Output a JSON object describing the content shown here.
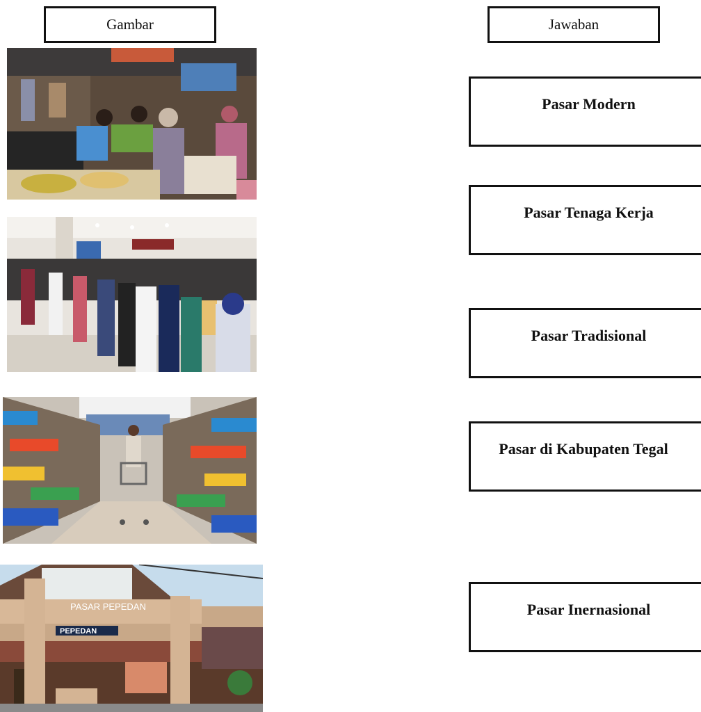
{
  "headers": {
    "left": "Gambar",
    "right": "Jawaban"
  },
  "answers": [
    "Pasar Modern",
    "Pasar Tenaga Kerja",
    "Pasar Tradisional",
    "Pasar di Kabupaten Tegal",
    "Pasar  Inernasional"
  ],
  "pictures": [
    {
      "name": "traditional-market-photo"
    },
    {
      "name": "job-fair-queue-photo"
    },
    {
      "name": "supermarket-aisle-photo"
    },
    {
      "name": "pasar-pepedan-gate-photo",
      "sign_text": "PASAR PEPEDAN",
      "building_sign_text": "PEPEDAN"
    }
  ]
}
